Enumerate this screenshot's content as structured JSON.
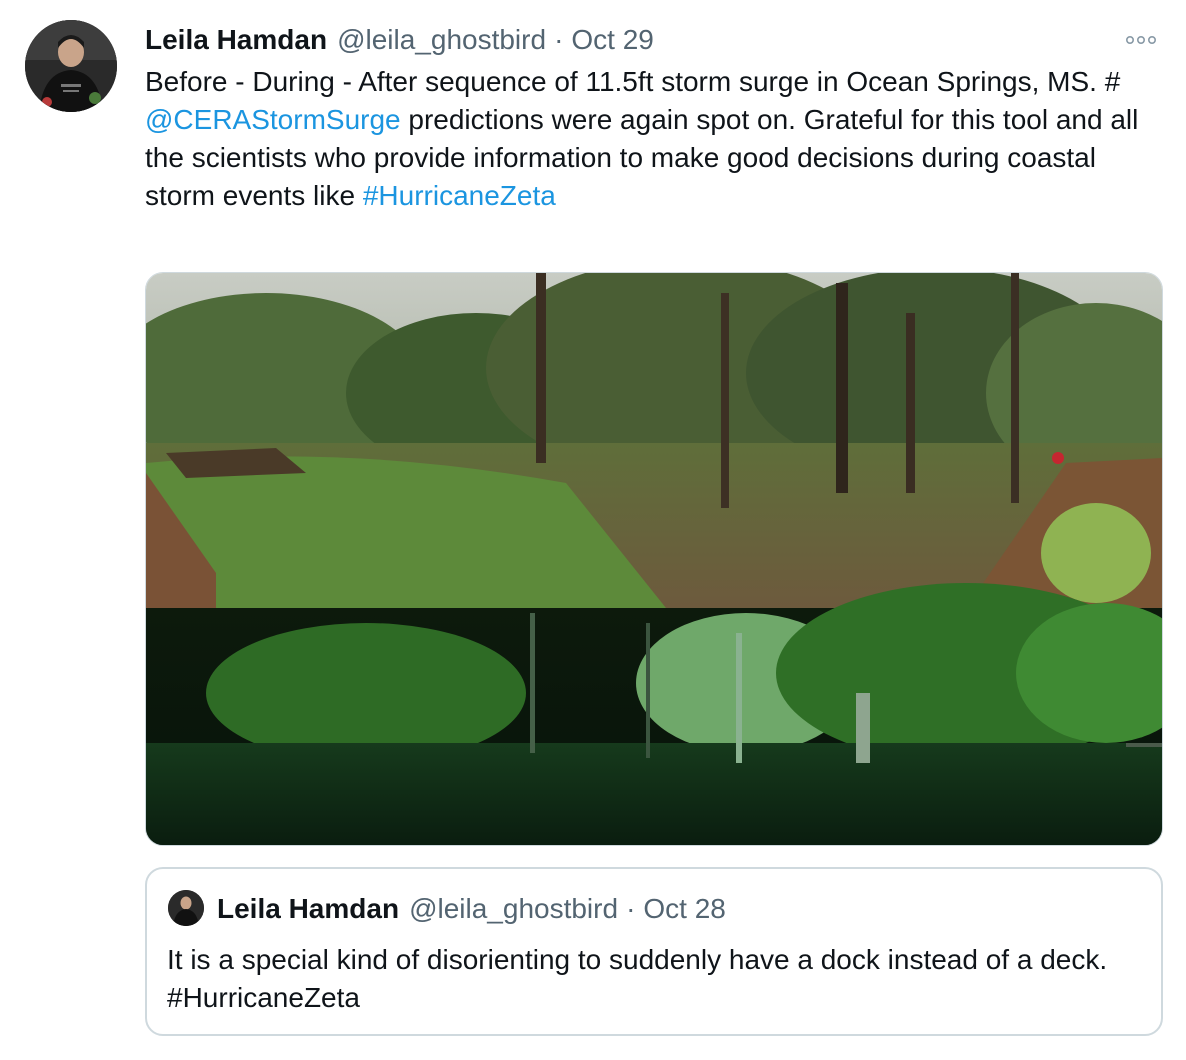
{
  "tweet": {
    "author_name": "Leila Hamdan",
    "author_handle": "@leila_ghostbird",
    "separator": "·",
    "date": "Oct 29",
    "text_line1": "Before - During - After sequence of 11.5ft storm surge in Ocean Springs, MS. #",
    "mention": "@CERAStormSurge",
    "text_line2": " predictions were again spot on. Grateful for this tool and all the scientists who provide information to make good decisions during coastal storm events like ",
    "hashtag": "#HurricaneZeta",
    "more_icon": "more-icon",
    "link_color": "#1b95e0"
  },
  "quoted_tweet": {
    "author_name": "Leila Hamdan",
    "author_handle": "@leila_ghostbird",
    "separator": "·",
    "date": "Oct 28",
    "text": "It is a special kind of disorienting to suddenly have a dock instead of a deck. #HurricaneZeta"
  }
}
